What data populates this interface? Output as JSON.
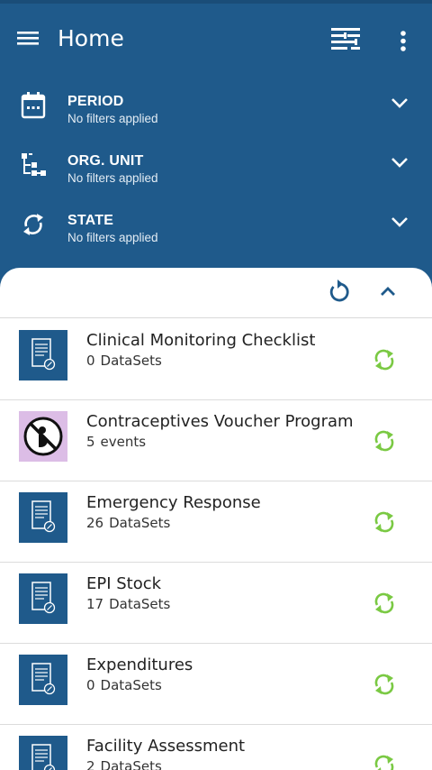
{
  "app": {
    "title": "Home",
    "accent": "#1f5a8b",
    "sync_color": "#7ac943"
  },
  "toolbar": {
    "menu_icon": "hamburger-menu-icon",
    "filter_icon": "filter-list-icon",
    "more_icon": "more-vertical-icon"
  },
  "filters": [
    {
      "label": "PERIOD",
      "status": "No filters applied",
      "icon": "calendar-icon"
    },
    {
      "label": "ORG. UNIT",
      "status": "No filters applied",
      "icon": "org-tree-icon"
    },
    {
      "label": "STATE",
      "status": "No filters applied",
      "icon": "sync-icon"
    }
  ],
  "sheet": {
    "refresh_icon": "refresh-icon",
    "collapse_icon": "chevron-up-icon"
  },
  "programs": [
    {
      "name": "Clinical Monitoring Checklist",
      "count": "0",
      "unit": "DataSets",
      "icon": "dataset-form-icon"
    },
    {
      "name": "Contraceptives Voucher Program",
      "count": "5",
      "unit": "events",
      "icon": "no-pregnancy-icon"
    },
    {
      "name": "Emergency Response",
      "count": "26",
      "unit": "DataSets",
      "icon": "dataset-form-icon"
    },
    {
      "name": "EPI Stock",
      "count": "17",
      "unit": "DataSets",
      "icon": "dataset-form-icon"
    },
    {
      "name": "Expenditures",
      "count": "0",
      "unit": "DataSets",
      "icon": "dataset-form-icon"
    },
    {
      "name": "Facility Assessment",
      "count": "2",
      "unit": "DataSets",
      "icon": "dataset-form-icon"
    }
  ]
}
